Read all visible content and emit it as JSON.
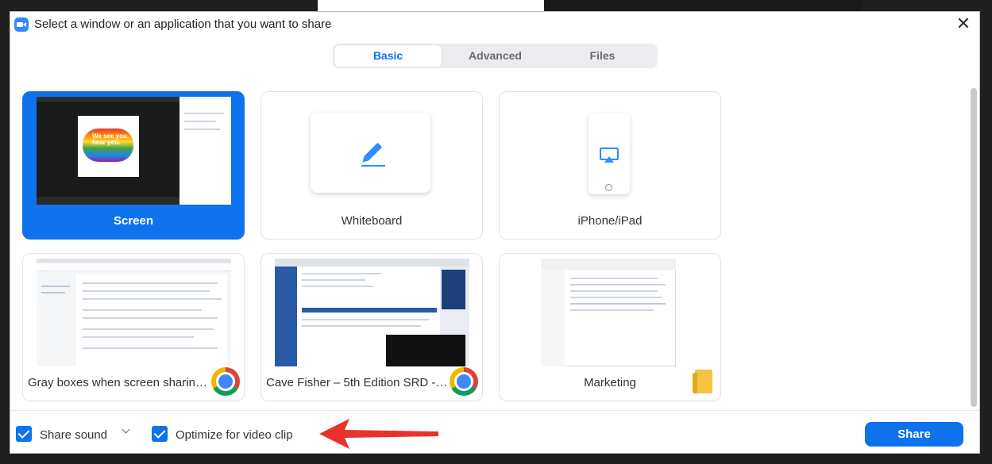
{
  "window": {
    "title": "Select a window or an application that you want to share",
    "close_glyph": "✕"
  },
  "tabs": [
    {
      "label": "Basic",
      "active": true
    },
    {
      "label": "Advanced",
      "active": false
    },
    {
      "label": "Files",
      "active": false
    }
  ],
  "cards": [
    {
      "label": "Screen",
      "selected": true,
      "icon": "screen-thumbnail"
    },
    {
      "label": "Whiteboard",
      "selected": false,
      "icon": "pencil-icon"
    },
    {
      "label": "iPhone/iPad",
      "selected": false,
      "icon": "airplay-icon"
    },
    {
      "label": "Gray boxes when screen sharing i...",
      "selected": false,
      "icon": "chrome-icon"
    },
    {
      "label": "Cave Fisher – 5th Edition SRD - G...",
      "selected": false,
      "icon": "chrome-icon"
    },
    {
      "label": "Marketing",
      "selected": false,
      "icon": "folder-icon"
    }
  ],
  "screen_thumb": {
    "art_text": "We see you. hear you."
  },
  "footer": {
    "share_sound_label": "Share sound",
    "optimize_label": "Optimize for video clip",
    "share_button": "Share"
  },
  "colors": {
    "accent": "#0e72ed",
    "annotation_arrow": "#e8332c"
  }
}
